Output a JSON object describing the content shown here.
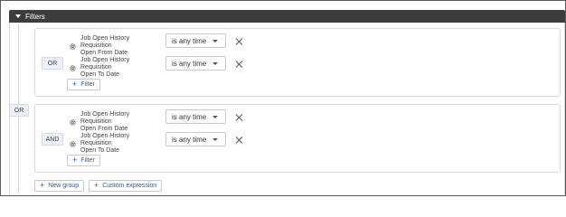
{
  "header": {
    "title": "Filters"
  },
  "root_operator": "OR",
  "groups": [
    {
      "operator": "OR",
      "conditions": [
        {
          "field_line1": "Job Open History Requisition",
          "field_line2": "Open From Date",
          "operator_value": "is any time"
        },
        {
          "field_line1": "Job Open History Requisition",
          "field_line2": "Open To Date",
          "operator_value": "is any time"
        }
      ],
      "add_filter_label": "Filter"
    },
    {
      "operator": "AND",
      "conditions": [
        {
          "field_line1": "Job Open History Requisition",
          "field_line2": "Open From Date",
          "operator_value": "is any time"
        },
        {
          "field_line1": "Job Open History Requisition",
          "field_line2": "Open To Date",
          "operator_value": "is any time"
        }
      ],
      "add_filter_label": "Filter"
    }
  ],
  "footer": {
    "new_group_label": "New group",
    "custom_expression_label": "Custom expression"
  },
  "icons": {
    "expand": "caret-down-icon",
    "field": "gear-icon",
    "remove": "close-icon",
    "add": "plus-icon",
    "dropdown": "chevron-down-icon"
  }
}
